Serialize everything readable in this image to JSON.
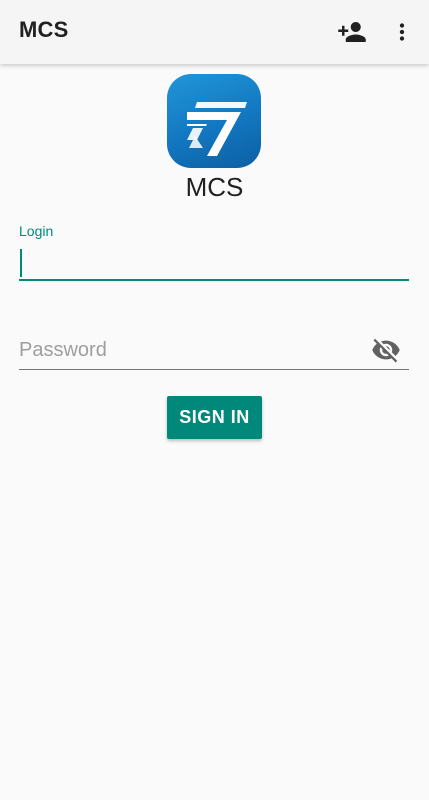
{
  "toolbar": {
    "title": "MCS",
    "actions": [
      {
        "icon": "person-add-icon"
      },
      {
        "icon": "more-vert-icon"
      }
    ]
  },
  "branding": {
    "app_name": "MCS",
    "logo_color": "#1a87cf"
  },
  "login_field": {
    "label": "Login",
    "value": ""
  },
  "password_field": {
    "placeholder": "Password",
    "value": "",
    "toggle_icon": "visibility-off-icon"
  },
  "sign_in": {
    "label": "SIGN IN"
  },
  "colors": {
    "accent": "#00897b",
    "background": "#fafafa",
    "toolbar": "#f5f5f5"
  }
}
